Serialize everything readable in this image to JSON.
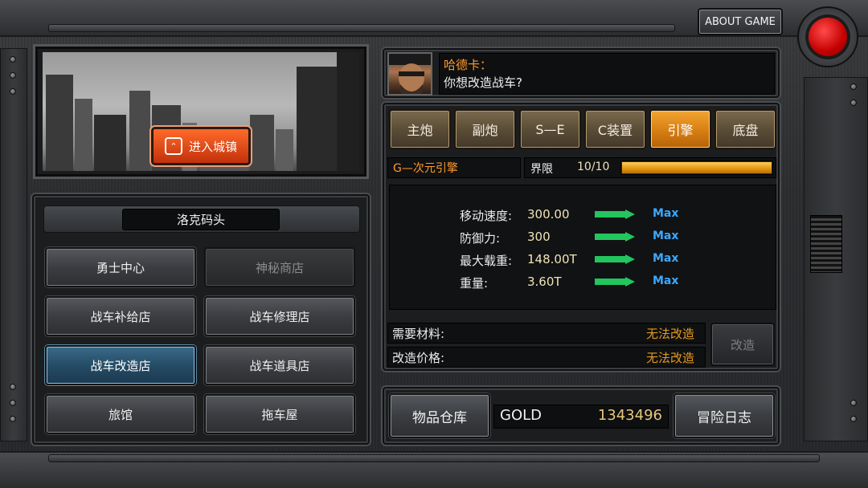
{
  "header": {
    "about_label": "ABOUT GAME"
  },
  "town": {
    "enter_label": "进入城镇",
    "location": "洛克码头"
  },
  "menu": [
    {
      "label": "勇士中心",
      "state": "normal"
    },
    {
      "label": "神秘商店",
      "state": "disabled"
    },
    {
      "label": "战车补给店",
      "state": "normal"
    },
    {
      "label": "战车修理店",
      "state": "normal"
    },
    {
      "label": "战车改造店",
      "state": "active"
    },
    {
      "label": "战车道具店",
      "state": "normal"
    },
    {
      "label": "旅馆",
      "state": "normal"
    },
    {
      "label": "拖车屋",
      "state": "normal"
    }
  ],
  "dialog": {
    "speaker": "哈德卡：",
    "text": "你想改造战车?"
  },
  "tabs": [
    {
      "label": "主炮",
      "active": false
    },
    {
      "label": "副炮",
      "active": false
    },
    {
      "label": "S—E",
      "active": false
    },
    {
      "label": "C装置",
      "active": false
    },
    {
      "label": "引擎",
      "active": true
    },
    {
      "label": "底盘",
      "active": false
    }
  ],
  "equipment": {
    "name": "G—次元引擎",
    "limit_label": "界限",
    "limit_value": "10/10",
    "limit_fraction": 1.0
  },
  "stats": [
    {
      "label": "移动速度:",
      "value": "300.00",
      "max": "Max"
    },
    {
      "label": "防御力:",
      "value": "300",
      "max": "Max"
    },
    {
      "label": "最大载重:",
      "value": "148.00T",
      "max": "Max"
    },
    {
      "label": "重量:",
      "value": "3.60T",
      "max": "Max"
    }
  ],
  "requirements": {
    "materials_label": "需要材料:",
    "materials_value": "无法改造",
    "price_label": "改造价格:",
    "price_value": "无法改造",
    "modify_button": "改造"
  },
  "footer": {
    "warehouse_button": "物品仓库",
    "gold_label": "GOLD",
    "gold_value": "1343496",
    "log_button": "冒险日志"
  },
  "colors": {
    "accent_orange": "#ff9a2e",
    "max_blue": "#3aa9ff",
    "arrow_green": "#22c55e",
    "record_red": "#e01010"
  }
}
